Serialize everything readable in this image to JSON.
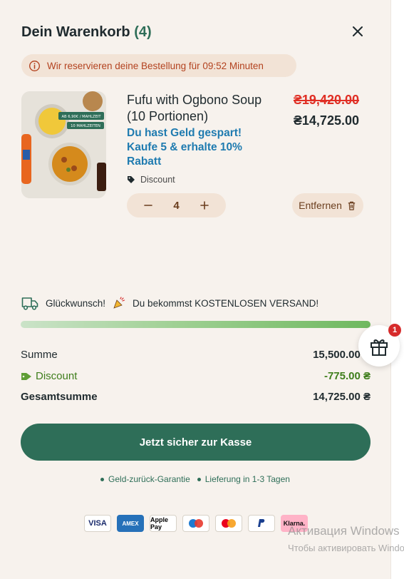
{
  "cart": {
    "title": "Dein Warenkorb",
    "count": "(4)",
    "close_icon": "close-icon"
  },
  "timer": {
    "text": "Wir reservieren deine Bestellung für 09:52 Minuten",
    "icon": "info-icon"
  },
  "item": {
    "title": "Fufu with Ogbono Soup (10 Portionen)",
    "old_price": "₴19,420.00",
    "new_price": "₴14,725.00",
    "promo": "Du hast Geld gespart! Kaufe 5 & erhalte 10% Rabatt",
    "tag": "Discount",
    "image_labels": [
      "AB 6,90€ / MAHLZEIT",
      "10 MAHLZEITEN"
    ],
    "quantity": "4",
    "remove_label": "Entfernen"
  },
  "shipping": {
    "text_before": "Glückwunsch!",
    "text_after": "Du bekommst KOSTENLOSEN VERSAND!",
    "progress": 1.0
  },
  "gift": {
    "badge": "1"
  },
  "summary": {
    "sum_label": "Summe",
    "sum_value": "15,500.00 ₴",
    "discount_label": "Discount",
    "discount_value": "-775.00 ₴",
    "total_label": "Gesamtsumme",
    "total_value": "14,725.00 ₴"
  },
  "checkout": {
    "label": "Jetzt sicher zur Kasse"
  },
  "guarantees": [
    "Geld-zurück-Garantie",
    "Lieferung in 1-3 Tagen"
  ],
  "payment_methods": [
    "VISA",
    "AMEX",
    "Apple Pay",
    "Maestro",
    "Mastercard",
    "PayPal",
    "Klarna."
  ],
  "watermark": {
    "line1": "Активация Windows",
    "line2": "Чтобы активировать Windows"
  },
  "colors": {
    "accent": "#2e6e58",
    "background": "#f7f2ed",
    "warning": "#b3421f",
    "price_old": "#e02e24",
    "promo": "#1f7bb0",
    "discount": "#3f7e1c"
  }
}
